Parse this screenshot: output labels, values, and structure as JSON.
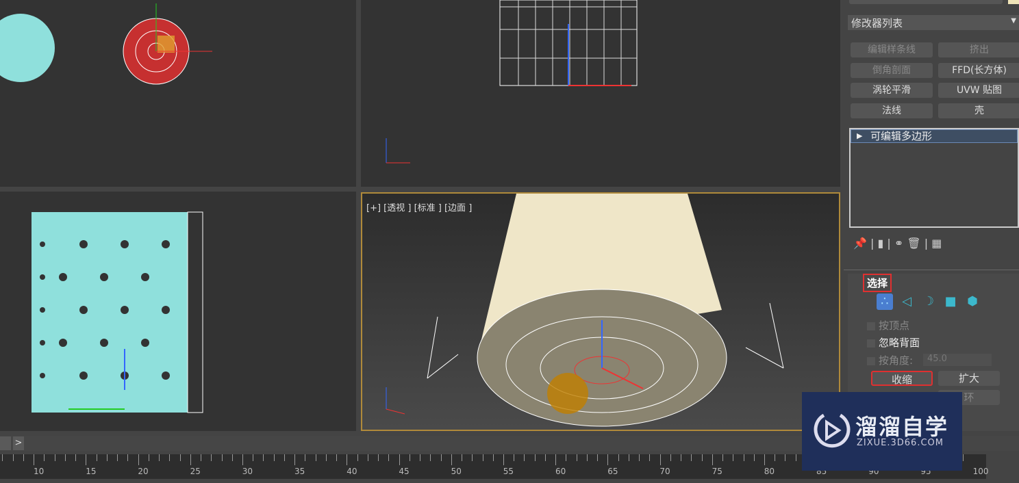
{
  "viewports": {
    "perspective_label": "[+] [透视 ] [标准 ] [边面 ]"
  },
  "panel": {
    "modifier_list": "修改器列表",
    "modifier_buttons": [
      {
        "label": "编辑样条线",
        "enabled": false
      },
      {
        "label": "挤出",
        "enabled": false
      },
      {
        "label": "倒角剖面",
        "enabled": false
      },
      {
        "label": "FFD(长方体)",
        "enabled": true
      },
      {
        "label": "涡轮平滑",
        "enabled": true
      },
      {
        "label": "UVW 贴图",
        "enabled": true
      },
      {
        "label": "法线",
        "enabled": true
      },
      {
        "label": "壳",
        "enabled": true
      }
    ],
    "stack_item": "可编辑多边形",
    "selection": {
      "title": "选择",
      "by_vertex": "按顶点",
      "ignore_backfacing": "忽略背面",
      "by_angle": "按角度:",
      "angle_value": "45.0",
      "shrink": "收缩",
      "grow": "扩大",
      "ring": "环"
    }
  },
  "timeline": {
    "ticks": [
      "10",
      "15",
      "20",
      "25",
      "30",
      "35",
      "40",
      "45",
      "50",
      "55",
      "60",
      "65",
      "70",
      "75",
      "80",
      "85",
      "90",
      "95",
      "100"
    ],
    "next": ">"
  },
  "watermark": {
    "title": "溜溜自学",
    "url": "ZIXUE.3D66.COM"
  },
  "colors": {
    "accent_red": "#e03030",
    "viewport_border": "#b08a3a",
    "selection_blue": "#4a7ed0"
  }
}
